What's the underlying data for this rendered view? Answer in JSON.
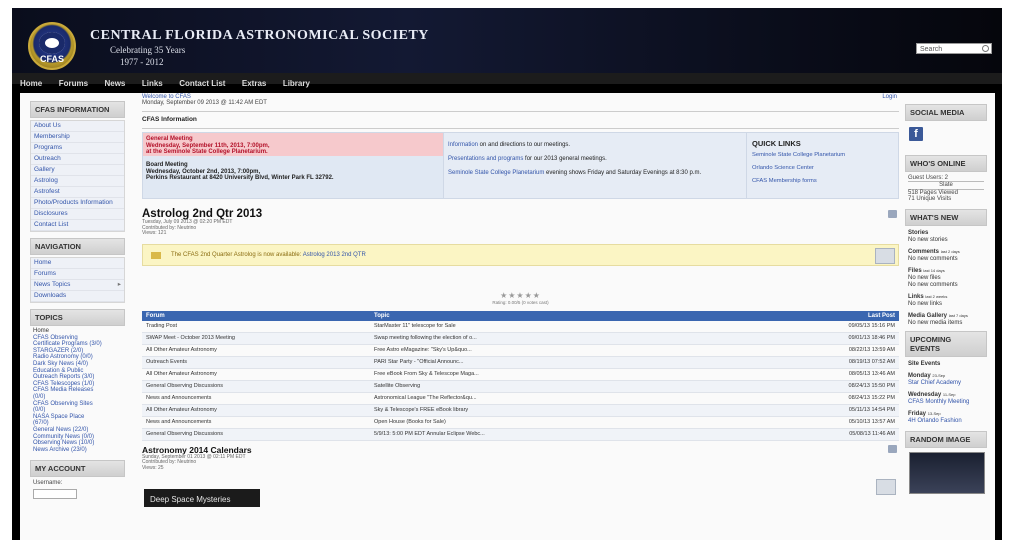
{
  "header": {
    "logo_text": "CFAS",
    "site_name": "CENTRAL FLORIDA ASTRONOMICAL SOCIETY",
    "tagline": "Celebrating 35 Years",
    "years": "1977 - 2012",
    "search_placeholder": "Search"
  },
  "topnav": [
    "Home",
    "Forums",
    "News",
    "Links",
    "Contact List",
    "Extras",
    "Library"
  ],
  "left": {
    "cfas_info_title": "CFAS INFORMATION",
    "cfas_info_items": [
      "About Us",
      "Membership",
      "Programs",
      "Outreach",
      "Gallery",
      "Astrolog",
      "Astrofest",
      "Photo/Products Information",
      "Disclosures",
      "Contact List"
    ],
    "nav_title": "NAVIGATION",
    "nav_items": [
      "Home",
      "Forums",
      "News Topics",
      "Downloads"
    ],
    "topics_title": "TOPICS",
    "topics_home": "Home",
    "topics": [
      "CFAS Observing",
      "Certificate Programs (3/0)",
      "STARGAZER (2/0)",
      "Radio Astronomy (0/0)",
      "Dark Sky News (4/0)",
      "Education & Public",
      "Outreach Reports (3/0)",
      "CFAS Telescopes (1/0)",
      "CFAS Media Releases",
      "(0/0)",
      "CFAS Observing Sites",
      "(0/0)",
      "NASA Space Place",
      "(67/0)",
      "General News (22/0)",
      "Community News (0/0)",
      "Observing News (10/0)",
      "News Archive (23/0)"
    ],
    "account_title": "MY ACCOUNT",
    "username_label": "Username:"
  },
  "main": {
    "welcome": "Welcome to CFAS",
    "date_line": "Monday, September 09 2013 @ 11:42 AM EDT",
    "login": "Login",
    "info_title": "CFAS Information",
    "meeting_title": "General Meeting",
    "meeting_line1": "Wednesday, September 11th, 2013, 7:00pm,",
    "meeting_line2": "at the Seminole State College Planetarium.",
    "board_title": "Board Meeting",
    "board_line1": "Wednesday, October 2nd, 2013, 7:00pm,",
    "board_line2": "Perkins Restaurant at 8420 University Blvd, Winter Park FL 32792.",
    "info_link1": "Information",
    "info_text1": " on and directions to our meetings.",
    "info_link2": "Presentations and programs",
    "info_text2": " for our 2013 general meetings.",
    "info_link3": "Seminole State College Planetarium",
    "info_text3": " evening shows Friday and Saturday Evenings at 8:30 p.m.",
    "quick_links_title": "QUICK LINKS",
    "quick_links": [
      "Seminole State College Planetarium",
      "Orlando Science Center",
      "CFAS Membership forms"
    ],
    "article1_title": "Astrolog 2nd Qtr 2013",
    "article1_meta1": "Tuesday, July 09 2013 @ 02:20 PM EDT",
    "article1_meta2": "Contributed by: Neutrino",
    "article1_meta3": "Views: 121",
    "notice_text": "The CFAS 2nd Quarter Astrolog is now available: ",
    "notice_link": "Astrolog 2013 2nd QTR",
    "rating_text": "Rating: 0.00/5 (0 votes cast)",
    "forum_headers": [
      "Forum",
      "Topic",
      "Last Post"
    ],
    "forum_rows": [
      [
        "Trading Post",
        "StarMaster 11\" telescope for Sale",
        "09/05/13 15:16 PM"
      ],
      [
        "SWAP Meet - October 2013 Meeting",
        "Swap meeting following the election of o...",
        "09/01/13 18:46 PM"
      ],
      [
        "All Other Amateur Astronomy",
        "Free Astro eMagazine: \"Sky's Up&quo...",
        "08/22/13 13:59 AM"
      ],
      [
        "Outreach Events",
        "PARI Star Party - \"Official Announc...",
        "08/19/13 07:52 AM"
      ],
      [
        "All Other Amateur Astronomy",
        "Free eBook From Sky & Telescope Maga...",
        "08/05/13 13:46 AM"
      ],
      [
        "General Observing Discussions",
        "Satellite Observing",
        "08/24/13 15:50 PM"
      ],
      [
        "News and Announcements",
        "Astronomical League \"The Reflector&qu...",
        "08/24/13 15:22 PM"
      ],
      [
        "All Other Amateur Astronomy",
        "Sky & Telescope's FREE eBook library",
        "05/11/13 14:54 PM"
      ],
      [
        "News and Announcements",
        "Open House (Books for Sale)",
        "05/10/13 13:57 AM"
      ],
      [
        "General Observing Discussions",
        "5/9/13: 5:00 PM EDT Annular Eclipse Webc...",
        "05/08/13 11:46 AM"
      ]
    ],
    "article2_title": "Astronomy 2014 Calendars",
    "article2_meta1": "Sunday, September 01 2013 @ 02:11 PM EDT",
    "article2_meta2": "Contributed by: Neutrino",
    "article2_meta3": "Views: 25",
    "dsm_text": "Deep Space Mysteries"
  },
  "right": {
    "social_title": "SOCIAL MEDIA",
    "facebook_glyph": "f",
    "whos_online_title": "WHO'S ONLINE",
    "online_lines": [
      "Guest Users: 2",
      "Slate",
      "518 Pages Viewed",
      "71 Unique Visits"
    ],
    "whats_new_title": "WHAT'S NEW",
    "new_items": [
      {
        "label": "Stories",
        "sub": "No new stories"
      },
      {
        "label": "Comments",
        "sub": "No new comments",
        "note": "last 2 days"
      },
      {
        "label": "Files",
        "sub": "No new files",
        "note": "last 14 days",
        "sub2": "No new comments"
      },
      {
        "label": "Links",
        "sub": "No new links",
        "note": "last 2 weeks"
      },
      {
        "label": "Media Gallery",
        "sub": "No new media items",
        "note": "last 7 days"
      }
    ],
    "upcoming_title": "UPCOMING EVENTS",
    "site_events": "Site Events",
    "events": [
      {
        "day": "Monday",
        "date": "23-Sep",
        "link": "Star Chief Academy"
      },
      {
        "day": "Wednesday",
        "date": "11-Sep",
        "link": "CFAS Monthly Meeting"
      },
      {
        "day": "Friday",
        "date": "13-Sep",
        "link": "4H Orlando Fashion"
      }
    ],
    "random_image_title": "RANDOM IMAGE"
  }
}
